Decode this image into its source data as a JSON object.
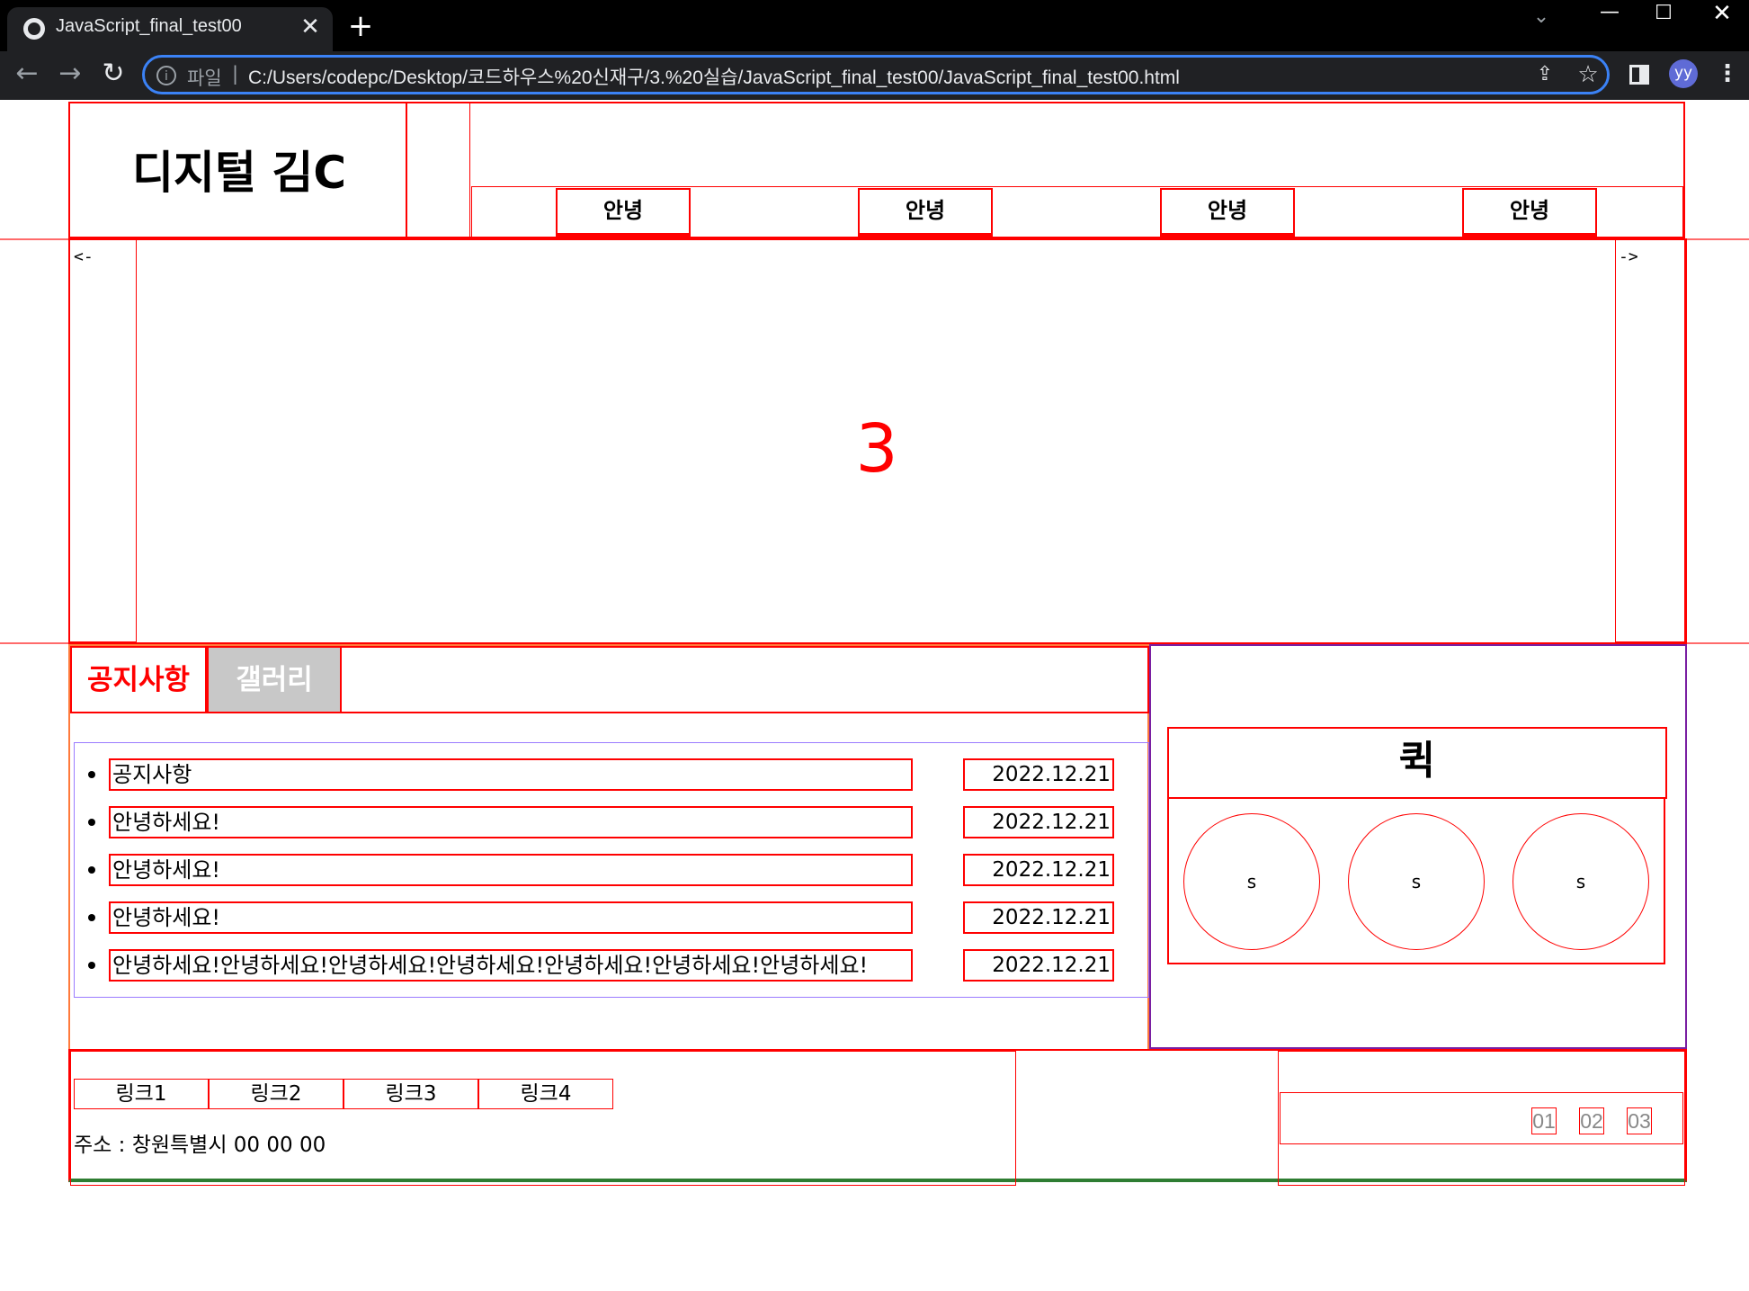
{
  "browser": {
    "tab_title": "JavaScript_final_test00",
    "tab_close": "✕",
    "new_tab": "+",
    "file_label": "파일",
    "url_separator": "|",
    "url": "C:/Users/codepc/Desktop/코드하우스%20신재구/3.%20실습/JavaScript_final_test00/JavaScript_final_test00.html",
    "avatar_initials": "yy",
    "icons": [
      "globe-icon",
      "close-icon",
      "plus-icon",
      "chevron-down-icon",
      "minimize-icon",
      "maximize-icon",
      "close-window-icon",
      "back-icon",
      "forward-icon",
      "reload-icon",
      "info-icon",
      "share-icon",
      "star-icon",
      "side-panel-icon",
      "kebab-menu-icon"
    ]
  },
  "header": {
    "logo": "디지털 김C",
    "nav": [
      "안녕",
      "안녕",
      "안녕",
      "안녕"
    ]
  },
  "slider": {
    "prev": "<-",
    "next": "->",
    "current_slide": "3"
  },
  "board": {
    "tabs": [
      {
        "label": "공지사항",
        "active": true
      },
      {
        "label": "갤러리",
        "active": false
      }
    ],
    "notices": [
      {
        "title": "공지사항",
        "date": "2022.12.21"
      },
      {
        "title": "안녕하세요!",
        "date": "2022.12.21"
      },
      {
        "title": "안녕하세요!",
        "date": "2022.12.21"
      },
      {
        "title": "안녕하세요!",
        "date": "2022.12.21"
      },
      {
        "title": "안녕하세요!안녕하세요!안녕하세요!안녕하세요!안녕하세요!안녕하세요!안녕하세요!",
        "date": "2022.12.21"
      }
    ]
  },
  "quick": {
    "title": "퀵",
    "items": [
      "s",
      "s",
      "s"
    ]
  },
  "footer": {
    "links": [
      "링크1",
      "링크2",
      "링크3",
      "링크4"
    ],
    "address": "주소 : 창원특별시 00 00 00",
    "pages": [
      "01",
      "02",
      "03"
    ]
  },
  "colors": {
    "border": "#ff0000",
    "active_tab": "#ff0000",
    "inactive_tab_bg": "#c8c8c8",
    "inactive_tab_text": "#ffffff",
    "quick_border": "#7a1fa2",
    "footer_border": "#2e7d32",
    "list_border": "#9b7bff"
  }
}
